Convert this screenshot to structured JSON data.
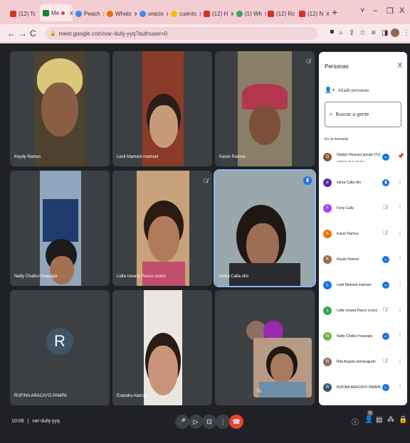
{
  "browser": {
    "tabs": [
      {
        "label": "(12) Tc",
        "color": "#d93025"
      },
      {
        "label": "Me",
        "color": "#188038"
      },
      {
        "label": "Peach",
        "color": "#4285f4"
      },
      {
        "label": "Whats",
        "color": "#e8710a"
      },
      {
        "label": "oracio",
        "color": "#4285f4"
      },
      {
        "label": "cuento",
        "color": "#fbbc04"
      },
      {
        "label": "(12) H",
        "color": "#d93025"
      },
      {
        "label": "(1) Wh",
        "color": "#34a853"
      },
      {
        "label": "(12) Rc",
        "color": "#d93025"
      },
      {
        "label": "(12) N",
        "color": "#d93025"
      }
    ],
    "new_tab": "+",
    "url": "meet.google.com/var-duhj-yyq?authuser=0",
    "window_controls": [
      "˅",
      "–",
      "❐",
      "X"
    ]
  },
  "tiles": [
    {
      "name": "Keydy Ramos",
      "bg": "#5a4a2f",
      "muted": false
    },
    {
      "name": "Lesli Mamani mamani",
      "bg": "#6a3a2a",
      "muted": false
    },
    {
      "name": "Karen Ramos",
      "bg": "#7a6d58",
      "muted": true
    },
    {
      "name": "Natty Challco huayapa",
      "bg": "#7b8fa3",
      "muted": false
    },
    {
      "name": "Lidia roxana Pacco ccuno",
      "bg": "#8a6c4b",
      "muted": true
    },
    {
      "name": "elena Calla ollo",
      "bg": "#8d99a1",
      "muted": false,
      "speaking": true
    },
    {
      "name": "RUFINA ARACAYO PAMPA",
      "bg": "#3c4043",
      "avatar": "R"
    },
    {
      "name": "Esandra Alarcon",
      "bg": "#3c4043"
    },
    {
      "name": "Tú",
      "bg": "#3c4043"
    }
  ],
  "panel": {
    "title": "Personas",
    "close": "X",
    "add_people": "Añadir personas",
    "search_placeholder": "Buscar a gente",
    "section": "En la llamada",
    "people": [
      {
        "name": "Gladys Huacasi quispe (Tú)",
        "sub": "Anfitrión de la reunión",
        "avatar": "G",
        "color": "#8a5a3c",
        "status": "dots"
      },
      {
        "name": "elena Calla ollo",
        "avatar": "e",
        "color": "#5b2ca0",
        "status": "speaking"
      },
      {
        "name": "Fany Calla",
        "avatar": "F",
        "color": "#a142f4",
        "status": "muted"
      },
      {
        "name": "Karen Ramos",
        "avatar": "K",
        "color": "#e8710a",
        "status": "muted"
      },
      {
        "name": "Keydy Ramos",
        "avatar": "K",
        "color": "#9c6a4a",
        "status": "dots"
      },
      {
        "name": "Lesli Mamani mamani",
        "avatar": "L",
        "color": "#1a73e8",
        "status": "dots"
      },
      {
        "name": "Lidia roxana Pacco ccuno",
        "avatar": "L",
        "color": "#34a853",
        "status": "muted"
      },
      {
        "name": "Natty Challco huayapa",
        "avatar": "N",
        "color": "#7cb342",
        "status": "dots"
      },
      {
        "name": "Rita Angela monteagudo",
        "avatar": "R",
        "color": "#8d6e63",
        "status": "muted"
      },
      {
        "name": "RUFINA ARACAYO PAMPA",
        "avatar": "R",
        "color": "#3d5567",
        "status": "dots"
      }
    ]
  },
  "bottom": {
    "clock": "10:09",
    "separator": "|",
    "meeting_code": "var-duhj-yyq",
    "participant_count": "11"
  },
  "colors": {
    "accent": "#1a73e8",
    "leave": "#ea4335",
    "background": "#202124"
  }
}
